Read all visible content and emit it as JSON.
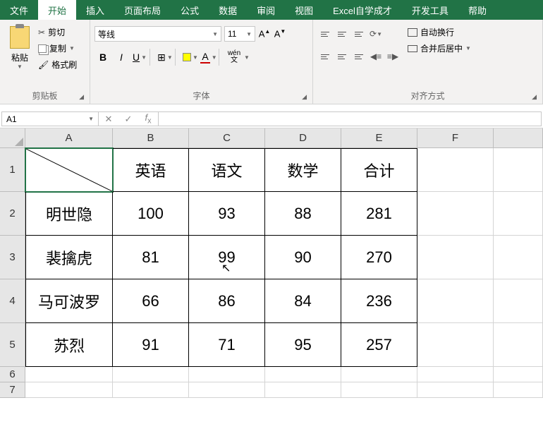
{
  "tabs": [
    "文件",
    "开始",
    "插入",
    "页面布局",
    "公式",
    "数据",
    "审阅",
    "视图",
    "Excel自学成才",
    "开发工具",
    "帮助"
  ],
  "active_tab_index": 1,
  "clipboard": {
    "paste": "粘贴",
    "cut": "剪切",
    "copy": "复制",
    "format_painter": "格式刷",
    "group": "剪贴板"
  },
  "font": {
    "name": "等线",
    "size": "11",
    "group": "字体",
    "wen": "wén"
  },
  "align": {
    "wrap": "自动换行",
    "merge": "合并后居中",
    "group": "对齐方式"
  },
  "namebox": "A1",
  "columns": [
    "A",
    "B",
    "C",
    "D",
    "E",
    "F"
  ],
  "rows": [
    "1",
    "2",
    "3",
    "4",
    "5",
    "6",
    "7"
  ],
  "headers": [
    "",
    "英语",
    "语文",
    "数学",
    "合计"
  ],
  "data": [
    [
      "明世隐",
      "100",
      "93",
      "88",
      "281"
    ],
    [
      "裴擒虎",
      "81",
      "99",
      "90",
      "270"
    ],
    [
      "马可波罗",
      "66",
      "86",
      "84",
      "236"
    ],
    [
      "苏烈",
      "91",
      "71",
      "95",
      "257"
    ]
  ],
  "chart_data": {
    "type": "table",
    "columns": [
      "",
      "英语",
      "语文",
      "数学",
      "合计"
    ],
    "rows": [
      [
        "明世隐",
        100,
        93,
        88,
        281
      ],
      [
        "裴擒虎",
        81,
        99,
        90,
        270
      ],
      [
        "马可波罗",
        66,
        86,
        84,
        236
      ],
      [
        "苏烈",
        91,
        71,
        95,
        257
      ]
    ]
  }
}
